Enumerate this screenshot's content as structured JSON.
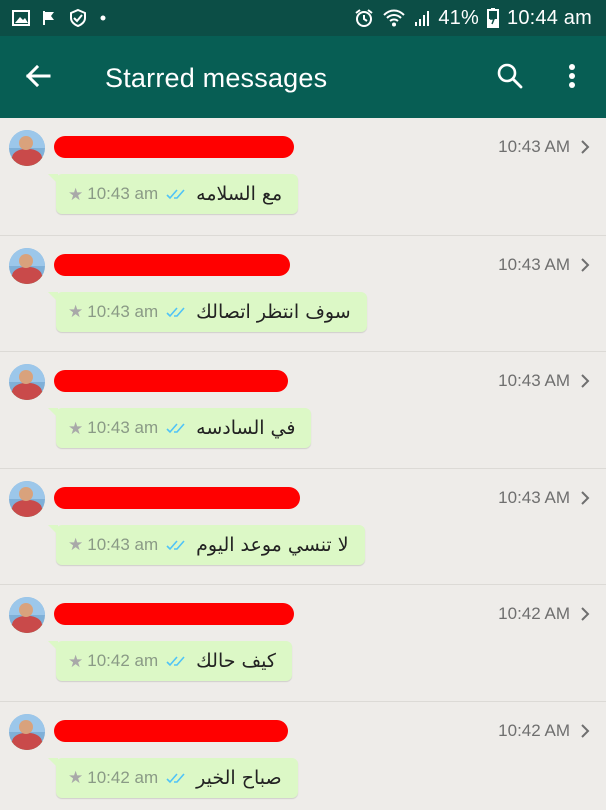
{
  "status_bar": {
    "battery": "41%",
    "time": "10:44 am",
    "icons": [
      "gallery-icon",
      "flag-icon",
      "shield-check-icon",
      "dot-icon",
      "alarm-icon",
      "wifi-icon",
      "signal-icon",
      "battery-icon"
    ]
  },
  "app_bar": {
    "title": "Starred messages",
    "icons": [
      "back-arrow-icon",
      "search-icon",
      "more-vert-icon"
    ],
    "color": "#075e54"
  },
  "items": [
    {
      "time": "10:43 AM",
      "message": "مع السلامه",
      "message_time": "10:43 am"
    },
    {
      "time": "10:43 AM",
      "message": "سوف انتظر اتصالك",
      "message_time": "10:43 am"
    },
    {
      "time": "10:43 AM",
      "message": "في السادسه",
      "message_time": "10:43 am"
    },
    {
      "time": "10:43 AM",
      "message": "لا تنسي موعد اليوم",
      "message_time": "10:43 am"
    },
    {
      "time": "10:42 AM",
      "message": "كيف حالك",
      "message_time": "10:42 am"
    },
    {
      "time": "10:42 AM",
      "message": "صباح الخير",
      "message_time": "10:42 am"
    }
  ],
  "colors": {
    "bubble": "#dcf8c6",
    "redaction": "#ff0000",
    "read_ticks": "#4fc3f7"
  }
}
